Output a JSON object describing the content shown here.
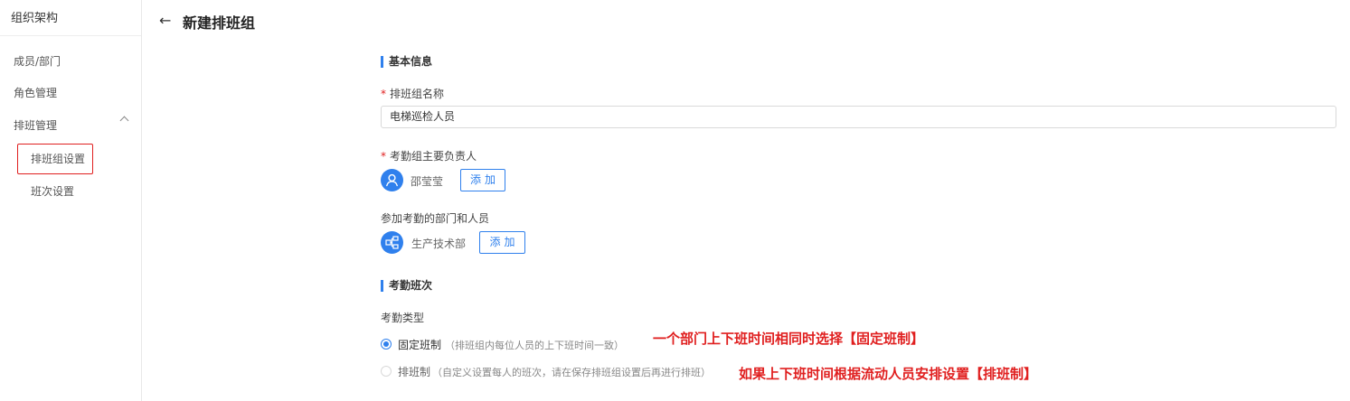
{
  "sidebar": {
    "title": "组织架构",
    "items": [
      "成员/部门",
      "角色管理",
      "排班管理"
    ],
    "sub_items": [
      "排班组设置",
      "班次设置"
    ]
  },
  "header": {
    "back_icon": "←",
    "title": "新建排班组"
  },
  "basic": {
    "section_title": "基本信息",
    "name_label": "排班组名称",
    "name_value": "电梯巡检人员",
    "owner_label": "考勤组主要负责人",
    "owner_name": "邵莹莹",
    "add_label": "添加",
    "members_label": "参加考勤的部门和人员",
    "member_dept": "生产技术部"
  },
  "shift": {
    "section_title": "考勤班次",
    "type_label": "考勤类型",
    "fixed_label": "固定班制",
    "fixed_hint": "（排班组内每位人员的上下班时间一致）",
    "flex_label": "排班制",
    "flex_hint": "（自定义设置每人的班次，请在保存排班组设置后再进行排班）"
  },
  "annotations": {
    "fixed_note": "一个部门上下班时间相同时选择【固定班制】",
    "flex_note": "如果上下班时间根据流动人员安排设置【排班制】"
  },
  "colors": {
    "accent": "#2f80ed",
    "annotation": "#e02020"
  }
}
